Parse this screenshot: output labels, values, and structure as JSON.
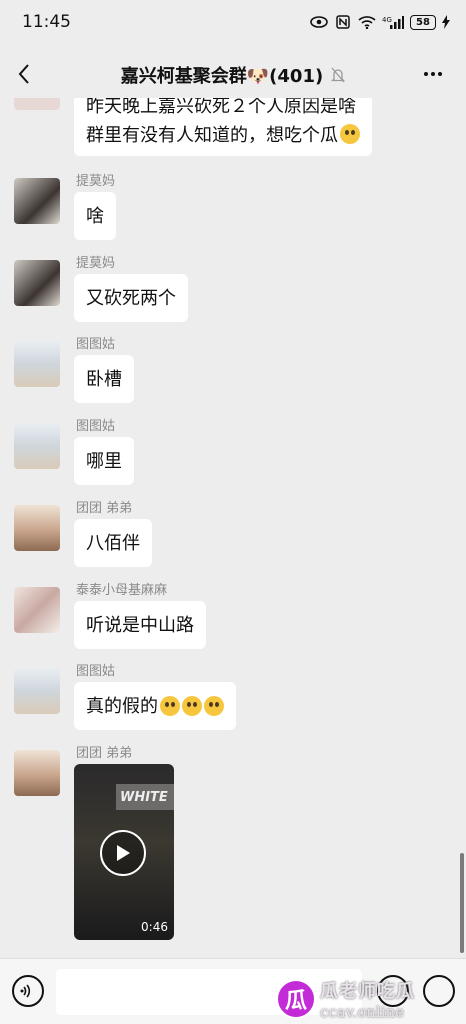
{
  "status_bar": {
    "time": "11:45",
    "battery": "58",
    "network": "4G"
  },
  "header": {
    "title": "嘉兴柯基聚会群🐶(401)"
  },
  "messages": [
    {
      "type": "text",
      "lines": [
        "昨天晚上嘉兴砍死２个人原因是啥",
        "群里有没有人知道的，想吃个瓜"
      ],
      "emoji": "face-emoji"
    },
    {
      "type": "text",
      "sender": "提莫妈",
      "text": "啥"
    },
    {
      "type": "text",
      "sender": "提莫妈",
      "text": "又砍死两个"
    },
    {
      "type": "text",
      "sender": "图图姑",
      "text": "卧槽"
    },
    {
      "type": "text",
      "sender": "图图姑",
      "text": "哪里"
    },
    {
      "type": "text",
      "sender": "团团 弟弟",
      "text": "八佰伴"
    },
    {
      "type": "text",
      "sender": "泰泰小母基麻麻",
      "text": "听说是中山路"
    },
    {
      "type": "text",
      "sender": "图图姑",
      "text": "真的假的",
      "emojis": 3
    },
    {
      "type": "video",
      "sender": "团团 弟弟",
      "sign_text": "WHITE",
      "duration": "0:46"
    }
  ],
  "watermark": {
    "logo": "瓜",
    "line1": "瓜老师吃瓜",
    "line2": "ccav.online"
  },
  "icons": {
    "back": "chevron-left-icon",
    "mute": "bell-off-icon",
    "more": "more-icon",
    "voice": "voice-icon",
    "emoji": "emoji-icon",
    "plus": "plus-icon"
  }
}
